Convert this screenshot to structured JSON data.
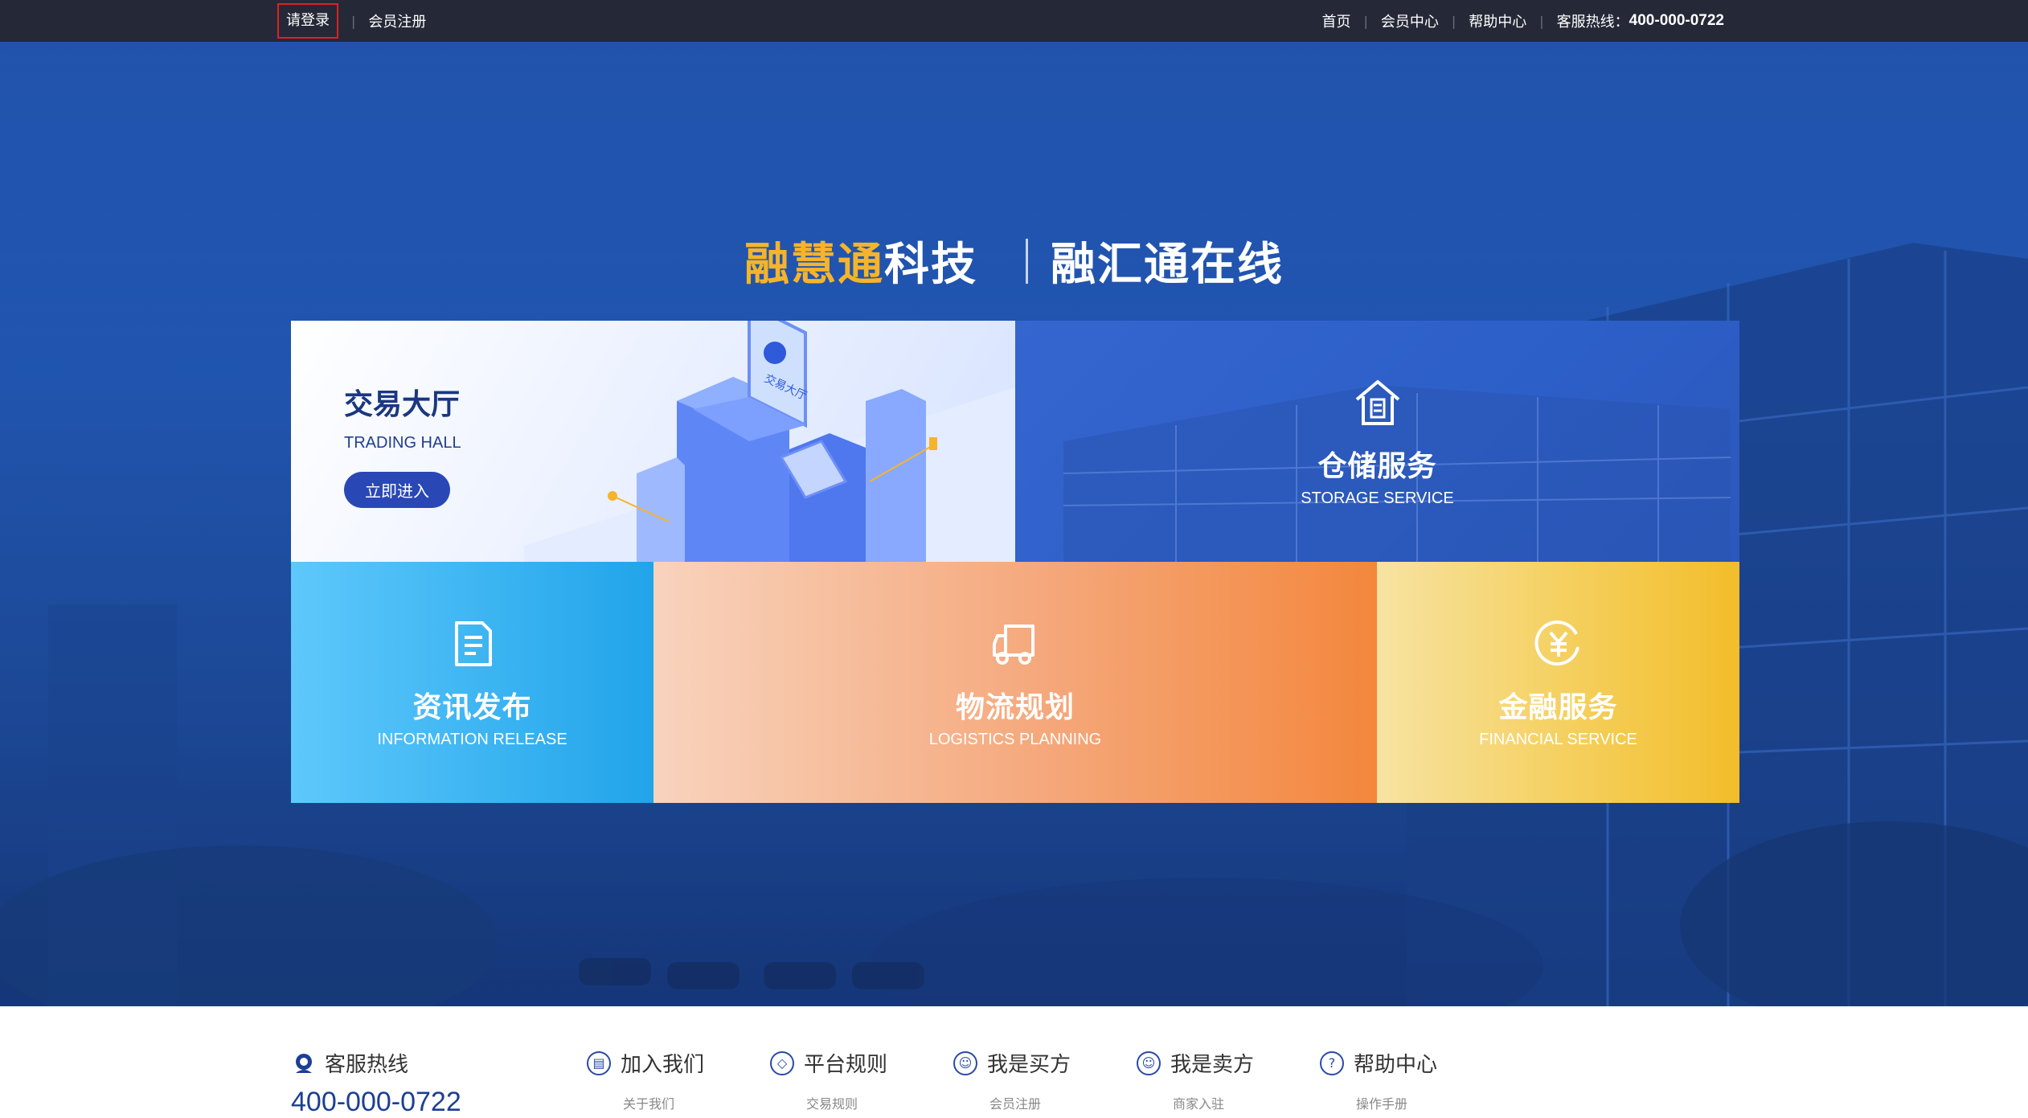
{
  "topbar": {
    "login": "请登录",
    "register": "会员注册",
    "home": "首页",
    "member_center": "会员中心",
    "help_center": "帮助中心",
    "hotline_label": "客服热线：",
    "hotline_number": "400-000-0722"
  },
  "slogan": {
    "gold": "融慧通",
    "white1": "科技",
    "white2": "融汇通在线"
  },
  "tiles": {
    "trading": {
      "title": "交易大厅",
      "sub": "TRADING HALL",
      "button": "立即进入",
      "icon": "laptop-illustration"
    },
    "storage": {
      "title": "仓储服务",
      "sub": "STORAGE SERVICE",
      "icon": "warehouse-icon"
    },
    "info": {
      "title": "资讯发布",
      "sub": "INFORMATION RELEASE",
      "icon": "document-icon"
    },
    "logistics": {
      "title": "物流规划",
      "sub": "LOGISTICS PLANNING",
      "icon": "truck-icon"
    },
    "finance": {
      "title": "金融服务",
      "sub": "FINANCIAL SERVICE",
      "icon": "yuan-icon"
    }
  },
  "footer": {
    "hotline_title": "客服热线",
    "hotline_number": "400-000-0722",
    "nav": [
      {
        "label": "加入我们",
        "sub": "关于我们"
      },
      {
        "label": "平台规则",
        "sub": "交易规则"
      },
      {
        "label": "我是买方",
        "sub": "会员注册"
      },
      {
        "label": "我是卖方",
        "sub": "商家入驻"
      },
      {
        "label": "帮助中心",
        "sub": "操作手册"
      }
    ]
  },
  "colors": {
    "topbar": "#252937",
    "gold": "#f6b42a",
    "brand_blue": "#2948b6"
  }
}
